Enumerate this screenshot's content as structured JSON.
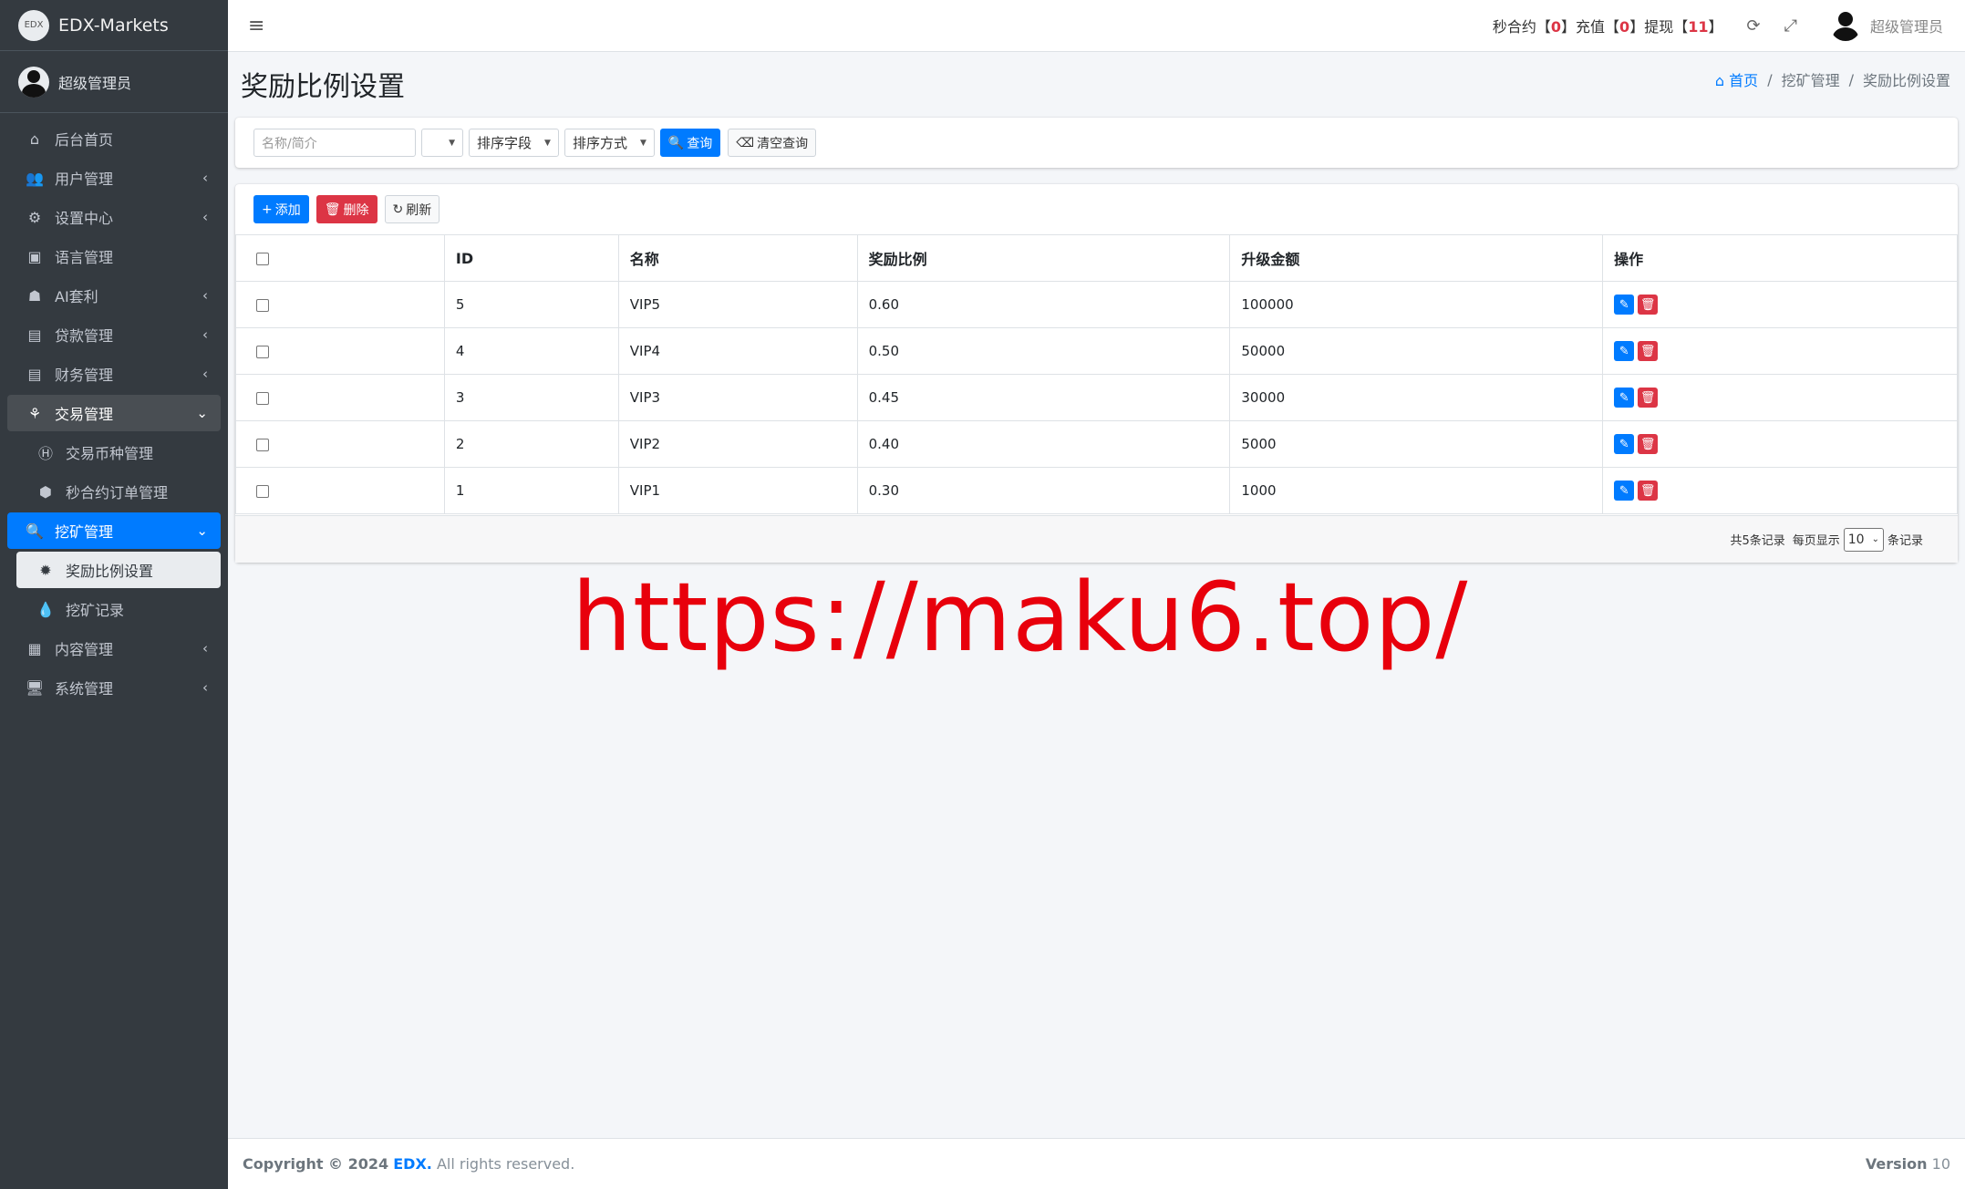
{
  "brand": {
    "logo_text": "EDX",
    "name": "EDX-Markets"
  },
  "sidebar": {
    "user_name": "超级管理员",
    "items": [
      {
        "label": "后台首页",
        "icon": "home-icon",
        "glyph": "⌂",
        "arrow": ""
      },
      {
        "label": "用户管理",
        "icon": "users-icon",
        "glyph": "👥",
        "arrow": "‹"
      },
      {
        "label": "设置中心",
        "icon": "cogs-icon",
        "glyph": "⚙",
        "arrow": "‹"
      },
      {
        "label": "语言管理",
        "icon": "language-icon",
        "glyph": "▣",
        "arrow": ""
      },
      {
        "label": "AI套利",
        "icon": "android-icon",
        "glyph": "☗",
        "arrow": "‹"
      },
      {
        "label": "贷款管理",
        "icon": "money-icon",
        "glyph": "▤",
        "arrow": "‹"
      },
      {
        "label": "财务管理",
        "icon": "money-icon",
        "glyph": "▤",
        "arrow": "‹"
      },
      {
        "label": "交易管理",
        "icon": "exchange-icon",
        "glyph": "⚘",
        "arrow": "⌄"
      },
      {
        "label": "交易币种管理",
        "icon": "coin-h-icon",
        "glyph": "Ⓗ",
        "arrow": ""
      },
      {
        "label": "秒合约订单管理",
        "icon": "cube-icon",
        "glyph": "⬢",
        "arrow": ""
      },
      {
        "label": "挖矿管理",
        "icon": "search-icon",
        "glyph": "🔍",
        "arrow": "⌄"
      },
      {
        "label": "奖励比例设置",
        "icon": "bug-icon",
        "glyph": "✹",
        "arrow": ""
      },
      {
        "label": "挖矿记录",
        "icon": "drop-icon",
        "glyph": "💧",
        "arrow": ""
      },
      {
        "label": "内容管理",
        "icon": "newspaper-icon",
        "glyph": "▦",
        "arrow": "‹"
      },
      {
        "label": "系统管理",
        "icon": "desktop-icon",
        "glyph": "🖥",
        "arrow": "‹"
      }
    ]
  },
  "topbar": {
    "menu_icon": "≡",
    "stats_prefix": "秒合约【",
    "stats_1": "0",
    "stats_mid1": "】充值【",
    "stats_2": "0",
    "stats_mid2": "】提现【",
    "stats_3": "11",
    "stats_suffix": "】",
    "refresh_glyph": "⟳",
    "fullscreen_glyph": "⤢",
    "user_name": "超级管理员"
  },
  "page": {
    "title": "奖励比例设置",
    "breadcrumb": {
      "home": "首页",
      "home_glyph": "⌂",
      "sep": "/",
      "level1": "挖矿管理",
      "current": "奖励比例设置"
    }
  },
  "filter": {
    "search_placeholder": "名称/简介",
    "select_blank": "",
    "sort_field": "排序字段",
    "sort_order": "排序方式",
    "query_label": "查询",
    "clear_label": "清空查询",
    "query_glyph": "🔍",
    "clear_glyph": "⌫"
  },
  "toolbar": {
    "add_label": "添加",
    "add_glyph": "+",
    "delete_label": "删除",
    "delete_glyph": "🗑",
    "refresh_label": "刷新",
    "refresh_glyph": "↻"
  },
  "table": {
    "columns": [
      "",
      "ID",
      "名称",
      "奖励比例",
      "升级金额",
      "操作"
    ],
    "rows": [
      {
        "id": "5",
        "name": "VIP5",
        "ratio": "0.60",
        "amount": "100000"
      },
      {
        "id": "4",
        "name": "VIP4",
        "ratio": "0.50",
        "amount": "50000"
      },
      {
        "id": "3",
        "name": "VIP3",
        "ratio": "0.45",
        "amount": "30000"
      },
      {
        "id": "2",
        "name": "VIP2",
        "ratio": "0.40",
        "amount": "5000"
      },
      {
        "id": "1",
        "name": "VIP1",
        "ratio": "0.30",
        "amount": "1000"
      }
    ],
    "edit_glyph": "✎",
    "delete_glyph": "🗑"
  },
  "pagination": {
    "total_text": "共5条记录",
    "per_page_label": "每页显示",
    "per_page_value": "10",
    "suffix": "条记录"
  },
  "watermark": "https://maku6.top/",
  "footer": {
    "copyright": "Copyright © 2024",
    "brand": "EDX.",
    "rights": "All rights reserved.",
    "version_label": "Version",
    "version_value": "10"
  },
  "colors": {
    "primary": "#007bff",
    "danger": "#dc3545",
    "sidebar": "#343a40",
    "watermark": "#e8000c"
  }
}
